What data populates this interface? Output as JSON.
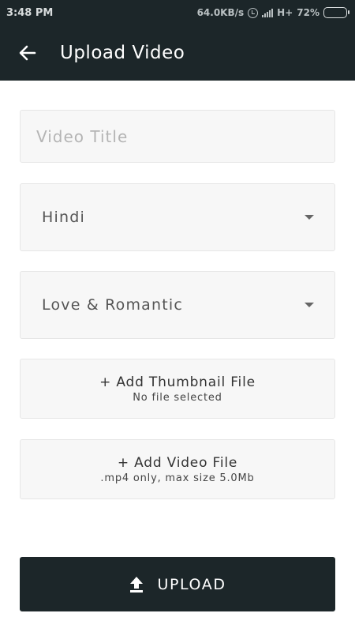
{
  "status_bar": {
    "time": "3:48 PM",
    "network_speed": "64.0KB/s",
    "network_type": "H+",
    "battery": "72%",
    "battery_level": 0.72
  },
  "appbar": {
    "title": "Upload Video",
    "back_icon": "arrow-left-icon"
  },
  "form": {
    "title_placeholder": "Video Title",
    "title_value": "",
    "language": "Hindi",
    "category": "Love & Romantic",
    "thumbnail": {
      "label": "+ Add Thumbnail File",
      "status": "No file selected"
    },
    "video": {
      "label": "+ Add Video File",
      "hint": ".mp4 only, max size 5.0Mb"
    },
    "upload_label": "UPLOAD",
    "upload_icon": "upload-icon"
  },
  "colors": {
    "primary_dark": "#1c2629",
    "field_background": "#f7f7f7",
    "placeholder": "#b4b4b4"
  }
}
